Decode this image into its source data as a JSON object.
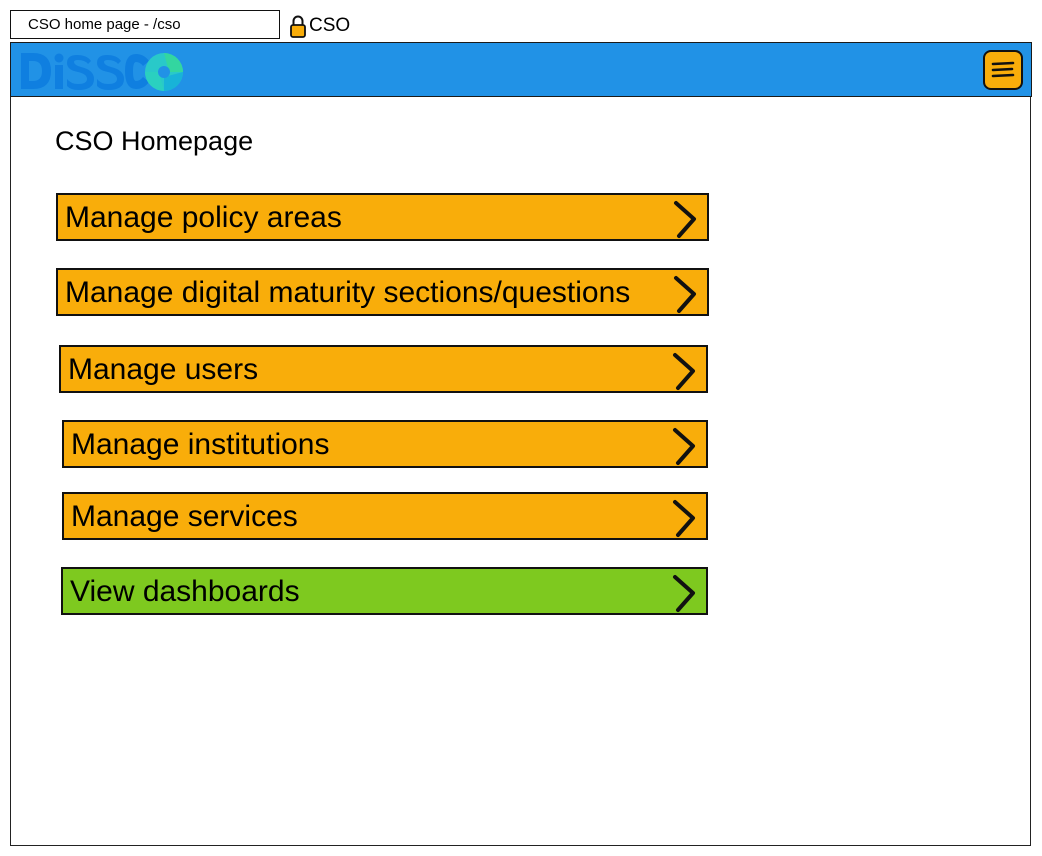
{
  "browser": {
    "tab_title": "CSO home page - /cso",
    "role_label": "CSO"
  },
  "header": {
    "logo_icon": "disco-logo-icon",
    "menu_icon": "hamburger-menu-icon"
  },
  "main": {
    "title": "CSO Homepage",
    "items": [
      {
        "label": "Manage policy areas",
        "color": "#f9ad0a"
      },
      {
        "label": "Manage digital maturity sections/questions",
        "color": "#f9ad0a"
      },
      {
        "label": "Manage users",
        "color": "#f9ad0a"
      },
      {
        "label": "Manage institutions",
        "color": "#f9ad0a"
      },
      {
        "label": "Manage services",
        "color": "#f9ad0a"
      },
      {
        "label": "View dashboards",
        "color": "#7ec91f"
      }
    ]
  },
  "colors": {
    "header_bar": "#2192e6",
    "accent_orange": "#f9ad0a",
    "accent_green": "#7ec91f"
  }
}
